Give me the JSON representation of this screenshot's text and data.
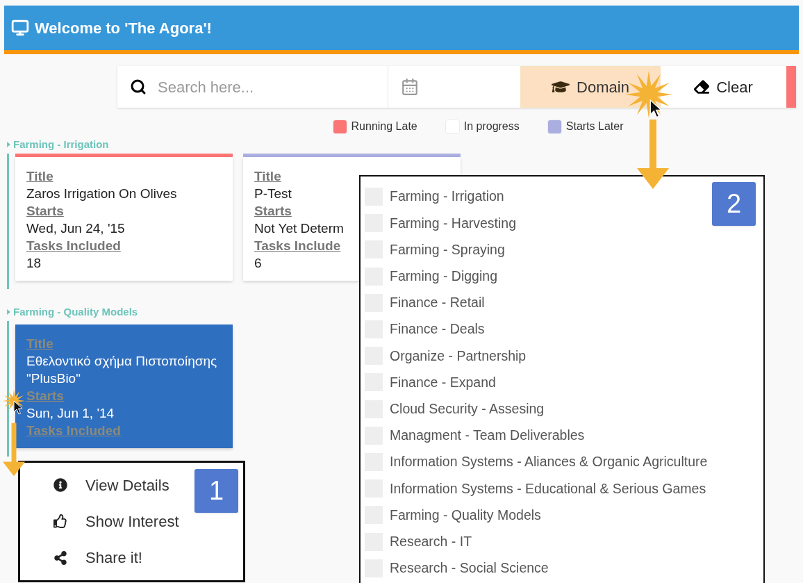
{
  "header": {
    "title": "Welcome to 'The Agora'!"
  },
  "search": {
    "placeholder": "Search here..."
  },
  "toolbar": [
    {
      "kind": "domain",
      "label": "Domain",
      "selected": true
    },
    {
      "kind": "clear",
      "label": "Clear",
      "selected": false
    }
  ],
  "legend": [
    {
      "label": "Running Late",
      "color": "#fc7575"
    },
    {
      "label": "In progress",
      "color": "#ffffff"
    },
    {
      "label": "Starts Later",
      "color": "#aaaee0"
    }
  ],
  "groups": [
    {
      "title": "Farming - Irrigation",
      "cards": [
        {
          "color": "#fc7575",
          "selected": false,
          "fields": [
            {
              "label": "Title",
              "value": "Zaros Irrigation On Olives"
            },
            {
              "label": "Starts",
              "value": "Wed, Jun 24, '15"
            },
            {
              "label": "Tasks Included",
              "value": "18"
            }
          ]
        },
        {
          "color": "#aaaee0",
          "selected": false,
          "fields": [
            {
              "label": "Title",
              "value": "P-Test"
            },
            {
              "label": "Starts",
              "value": "Not Yet Determ"
            },
            {
              "label": "Tasks Include",
              "value": "6"
            }
          ]
        }
      ]
    },
    {
      "title": "Farming - Quality Models",
      "cards": [
        {
          "selected": true,
          "fields": [
            {
              "label": "Title",
              "value": "Εθελοντικό σχήμα Πιστοποίησης \"PlusBio\""
            },
            {
              "label": "Starts",
              "value": "Sun, Jun 1, '14"
            },
            {
              "label": "Tasks Included"
            }
          ]
        }
      ]
    }
  ],
  "context_menu": [
    {
      "kind": "info",
      "label": "View Details"
    },
    {
      "kind": "like",
      "label": "Show Interest"
    },
    {
      "kind": "share",
      "label": "Share it!"
    }
  ],
  "domain_dropdown": [
    {
      "label": "Farming - Irrigation",
      "checked": false
    },
    {
      "label": "Farming - Harvesting",
      "checked": false
    },
    {
      "label": "Farming - Spraying",
      "checked": false
    },
    {
      "label": "Farming - Digging",
      "checked": false
    },
    {
      "label": "Finance - Retail",
      "checked": false
    },
    {
      "label": "Finance - Deals",
      "checked": false
    },
    {
      "label": "Organize - Partnership",
      "checked": false
    },
    {
      "label": "Finance - Expand",
      "checked": false
    },
    {
      "label": "Cloud Security - Assesing",
      "checked": false
    },
    {
      "label": "Managment - Team Deliverables",
      "checked": false
    },
    {
      "label": "Information Systems - Aliances & Organic Agriculture",
      "checked": false
    },
    {
      "label": "Information Systems - Educational & Serious Games",
      "checked": false
    },
    {
      "label": "Farming - Quality Models",
      "checked": false
    },
    {
      "label": "Research - IT",
      "checked": false
    },
    {
      "label": "Research - Social Science",
      "checked": false
    }
  ],
  "callouts": [
    "1",
    "2"
  ]
}
